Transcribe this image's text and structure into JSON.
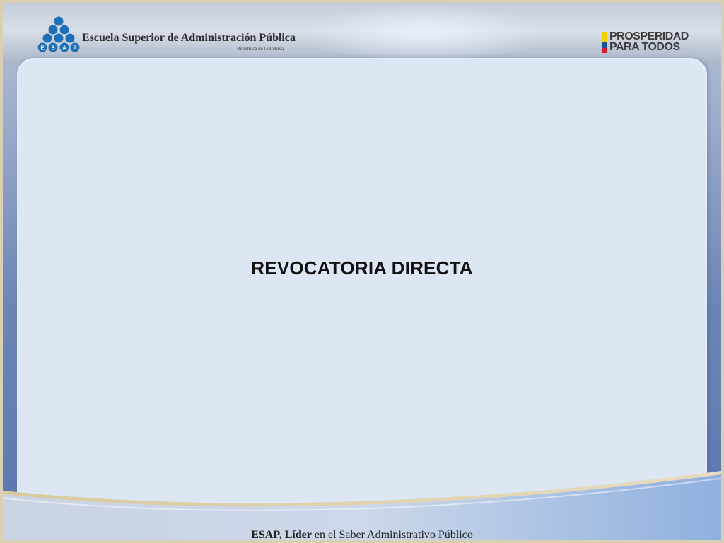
{
  "header": {
    "institution_name": "Escuela Superior de Administración Pública",
    "institution_subtitle": "República de Colombia",
    "logo_letters": "ESAP",
    "slogan_line1": "PROSPERIDAD",
    "slogan_line2": "PARA TODOS"
  },
  "slide": {
    "title": "REVOCATORIA DIRECTA"
  },
  "footer": {
    "tagline_bold": "ESAP, Líder",
    "tagline_rest": " en el Saber Administrativo Público"
  },
  "colors": {
    "logo_blue": "#1f6fb6",
    "flag_yellow": "#f5d000",
    "flag_blue": "#1d4f9c",
    "flag_red": "#d0202e",
    "panel_background": "#dde7f4",
    "frame_blue": "#5a76b0"
  }
}
